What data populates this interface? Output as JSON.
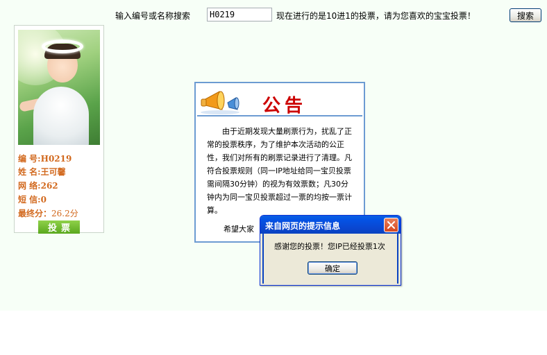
{
  "search": {
    "label": "输入编号或名称搜索",
    "value": "H0219",
    "vote_info": "现在进行的是10进1的投票，请为您喜欢的宝宝投票！",
    "button_label": "搜索"
  },
  "candidate": {
    "id_label": "编 号:",
    "id_value": "H0219",
    "name_label": "姓 名:",
    "name_value": "王可馨",
    "net_label": "网 络:",
    "net_value": "262",
    "sms_label": "短 信:",
    "sms_value": "0",
    "score_label": "最终分：",
    "score_value": "26.2分",
    "vote_button": "投票"
  },
  "notice": {
    "title": "公告",
    "body": "由于近期发现大量刷票行为，扰乱了正常的投票秩序，为了维护本次活动的公正性，我们对所有的刷票记录进行了清理。凡符合投票规则（同一IP地址给同一宝贝投票需间隔30分钟）的视为有效票数；凡30分钟内为同一宝贝投票超过一票的均按一票计算。",
    "closing": "希望大家"
  },
  "dialog": {
    "title": "来自网页的提示信息",
    "message": "感谢您的投票！您IP已经投票1次",
    "ok_label": "确定"
  },
  "colors": {
    "accent_orange": "#d2691e",
    "notice_red": "#cc0000",
    "vote_green": "#5aa81e",
    "xp_blue": "#0a46d0"
  }
}
